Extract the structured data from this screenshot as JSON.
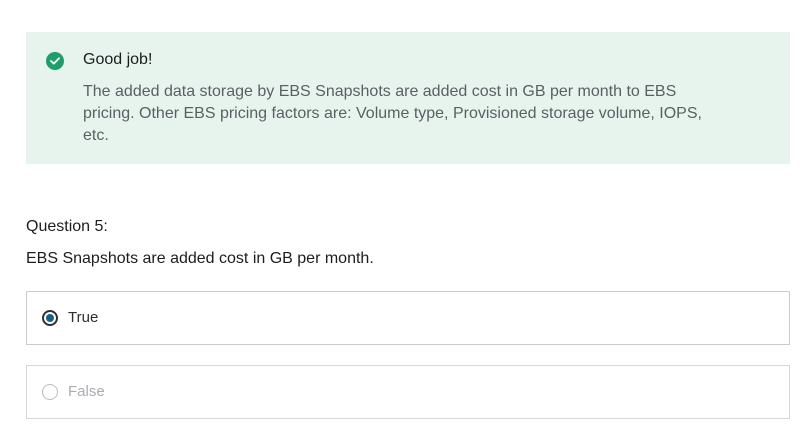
{
  "feedback": {
    "icon": "check-circle-icon",
    "color": "#1e9e6a",
    "background": "#e7f4ee",
    "title": "Good job!",
    "description": "The added data storage by EBS Snapshots are added cost in GB per month to EBS pricing. Other EBS pricing factors are: Volume type, Provisioned storage volume, IOPS, etc."
  },
  "question": {
    "label": "Question 5:",
    "text": "EBS Snapshots are added cost in GB per month.",
    "options": [
      {
        "label": "True",
        "selected": true
      },
      {
        "label": "False",
        "selected": false
      }
    ]
  }
}
